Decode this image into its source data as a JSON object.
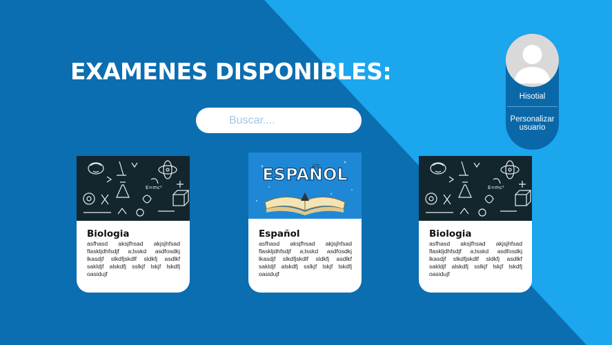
{
  "page": {
    "title": "EXAMENES DISPONIBLES:",
    "colors": {
      "background_dark": "#0b6eb0",
      "background_light": "#1ba6ee",
      "card": "#ffffff"
    }
  },
  "search": {
    "placeholder": "Buscar....",
    "value": ""
  },
  "user_menu": {
    "avatar_icon": "user-avatar-icon",
    "items": [
      {
        "label": "Hisotial"
      },
      {
        "label": "Personalizar usuario"
      }
    ]
  },
  "exams": [
    {
      "title": "Biologia",
      "image": "science-chalkboard-illustration",
      "description": "asfhasd aksjfhsad akjsjhfsad flaskljdhfsdjf a;lsskd asdfosdkj lkasdjf slkdfjskdlf sldkfj asdlkf sakldjf alskdfj sslkjf lskjf lskdfj oasidujf"
    },
    {
      "title": "Español",
      "image": "espanol-open-book-illustration",
      "image_text": "ESPAÑOL",
      "description": "asfhasd aksjfhsad akjsjhfsad flaskljdhfsdjf a;lsskd asdfosdkj lkasdjf slkdfjskdlf sldkfj asdlkf sakldjf alskdfj sslkjf lskjf lskdfj oasidujf"
    },
    {
      "title": "Biologia",
      "image": "science-chalkboard-illustration",
      "description": "asfhasd aksjfhsad akjsjhfsad flaskljdhfsdjf a;lsskd asdfosdkj lkasdjf slkdfjskdlf sldkfj asdlkf sakldjf alskdfj sslkjf lskjf lskdfj oasidujf"
    }
  ]
}
